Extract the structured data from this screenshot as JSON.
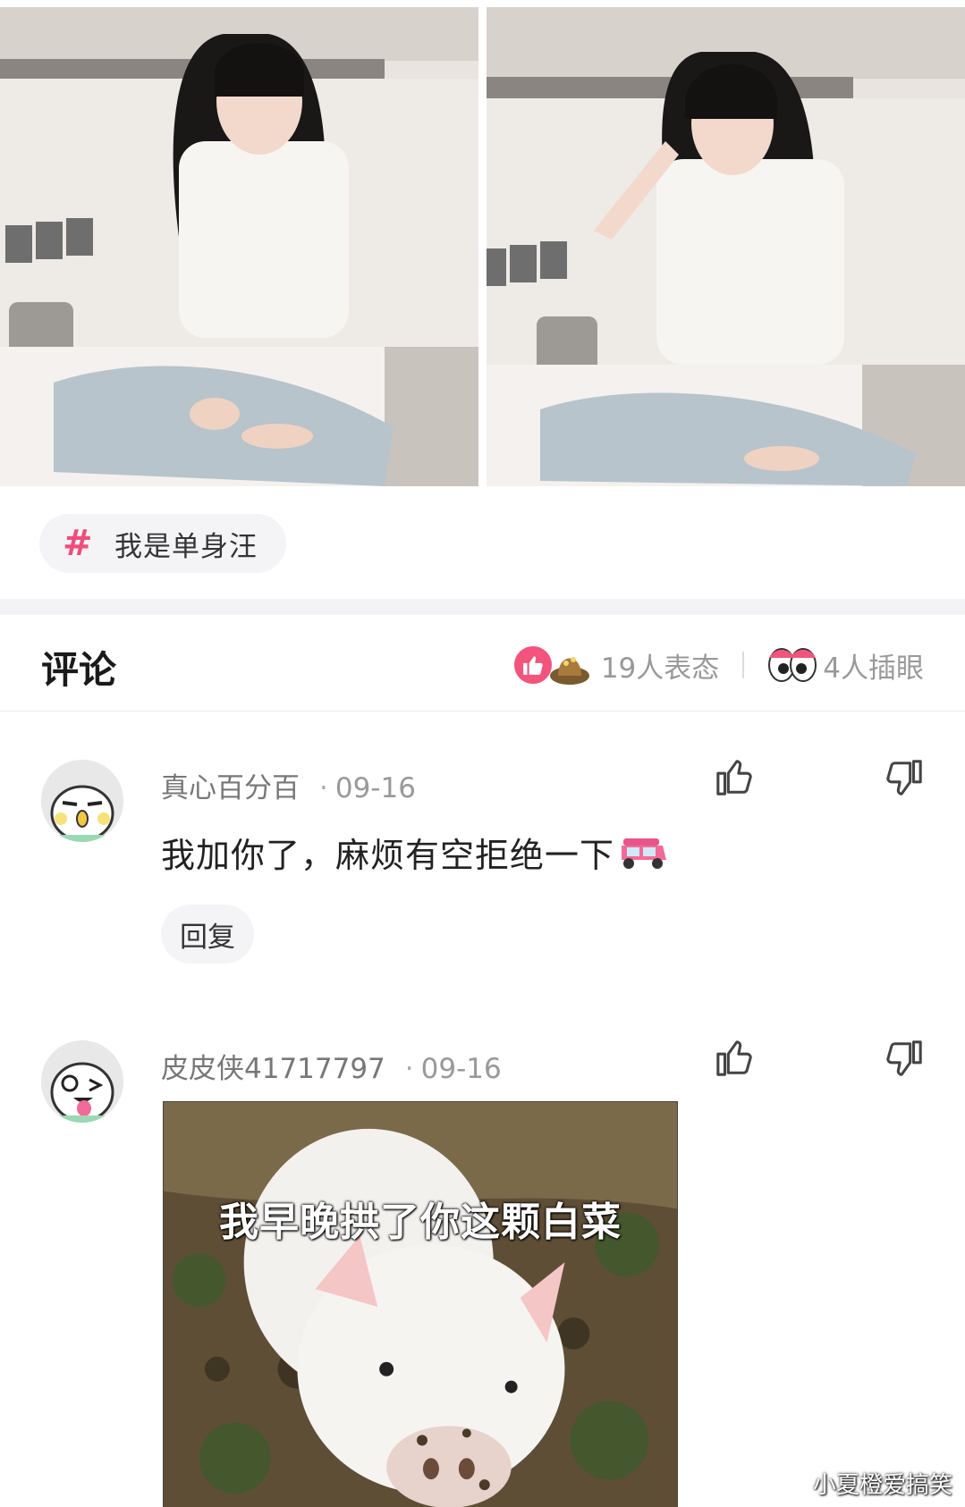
{
  "topic": {
    "symbol": "#",
    "label": "我是单身汪"
  },
  "comments_header": {
    "title": "评论",
    "reactions_text": "19人表态",
    "peeks_text": "4人插眼"
  },
  "comments": [
    {
      "username": "真心百分百",
      "dot": "·",
      "date": "09-16",
      "text": "我加你了，麻烦有空拒绝一下",
      "reply_label": "回复"
    },
    {
      "username": "皮皮侠41717797",
      "dot": "·",
      "date": "09-16",
      "sticker_caption": "我早晚拱了你这颗白菜"
    }
  ],
  "watermark": "小夏橙爱搞笑",
  "colors": {
    "accent": "#f04d7a",
    "like_badge": "#f2547e"
  }
}
